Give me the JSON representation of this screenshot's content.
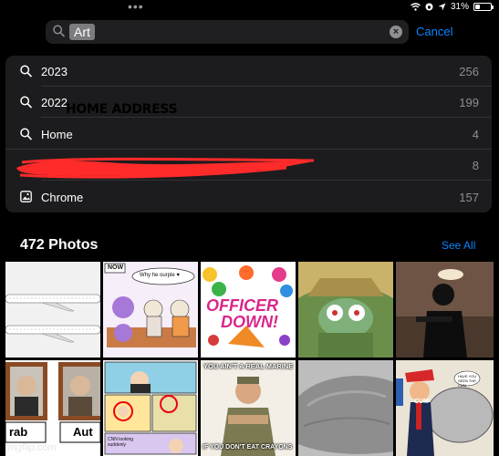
{
  "status_bar": {
    "battery_text": "31%",
    "battery_level": 0.31
  },
  "search": {
    "query": "Art",
    "cancel_label": "Cancel"
  },
  "suggestions": [
    {
      "label": "2023",
      "count": "256",
      "icon": "search-icon"
    },
    {
      "label": "2022",
      "count": "199",
      "icon": "search-icon"
    },
    {
      "label": "Home",
      "count": "4",
      "icon": "search-icon"
    },
    {
      "label": "HOME ADDRESS",
      "count": "8",
      "icon": "search-icon"
    },
    {
      "label": "Chrome",
      "count": "157",
      "icon": "photo-app-icon"
    }
  ],
  "photos": {
    "title": "472 Photos",
    "see_all_label": "See All"
  },
  "thumbnails": {
    "speech_bubble": "Why he ourple ♥",
    "now_tag": "NOW",
    "officer_line1": "OFFICER",
    "officer_line2": "DOWN!",
    "marine_top": "YOU AIN'T A REAL MARINE",
    "marine_bottom": "IF YOU DON'T EAT CRAYONS",
    "portrait_left_label": "rab",
    "portrait_right_label": "Aut",
    "comic_caption": "CNN looking suddenly",
    "cartoon_bubble": "HAVE YOU SEEN THE CUM",
    "cartoon_hat_text": "CUM"
  },
  "watermark": "imgflip.com",
  "colors": {
    "accent": "#0a84ff",
    "redaction": "#ff2a2a"
  }
}
